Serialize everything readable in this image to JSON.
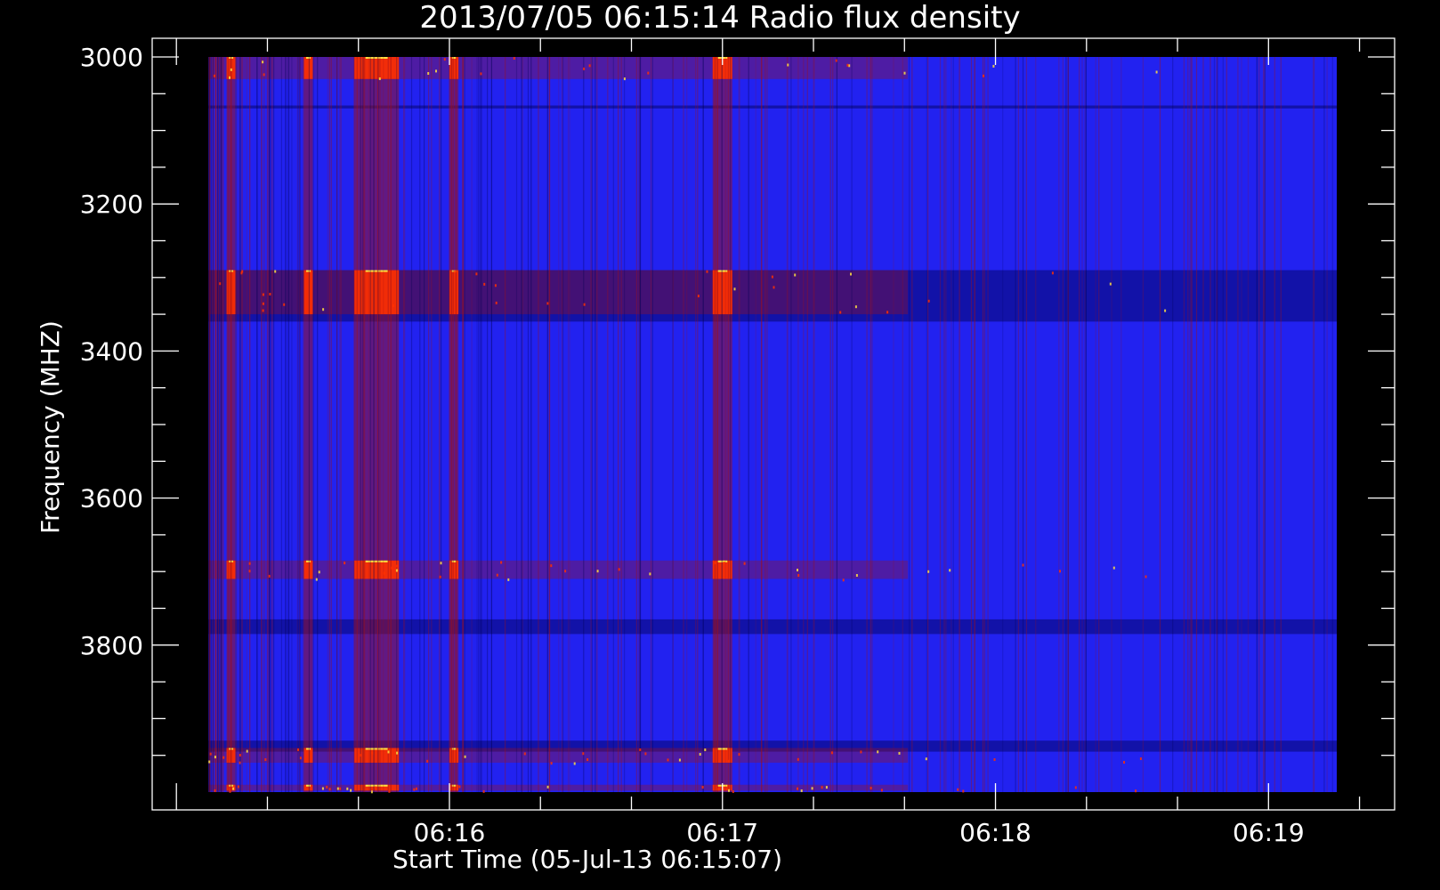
{
  "chart_data": {
    "type": "heatmap",
    "title": "2013/07/05 06:15:14 Radio flux density",
    "xlabel": "Start Time (05-Jul-13 06:15:07)",
    "ylabel": "Frequency (MHZ)",
    "x_range": [
      "06:15:07",
      "06:19:15"
    ],
    "y_range": [
      3000,
      4000
    ],
    "y_inverted": true,
    "x_ticks": [
      "06:16",
      "06:17",
      "06:18",
      "06:19"
    ],
    "y_ticks": [
      3000,
      3200,
      3400,
      3600,
      3800
    ],
    "colors": {
      "background": "#2222f0",
      "dark": "#000050",
      "medium": "#a01018",
      "hot": "#ff3000",
      "peak": "#ffe040"
    },
    "burst_times": [
      "06:15:12",
      "06:15:29",
      "06:15:44",
      "06:16:01",
      "06:17:00"
    ],
    "bright_bands_mhz": [
      [
        3000,
        3030
      ],
      [
        3290,
        3350
      ],
      [
        3685,
        3710
      ],
      [
        3940,
        3960
      ],
      [
        3990,
        3998
      ]
    ],
    "dark_bands_mhz": [
      [
        3066,
        3070
      ],
      [
        3290,
        3360
      ],
      [
        3765,
        3785
      ],
      [
        3930,
        3945
      ]
    ]
  }
}
